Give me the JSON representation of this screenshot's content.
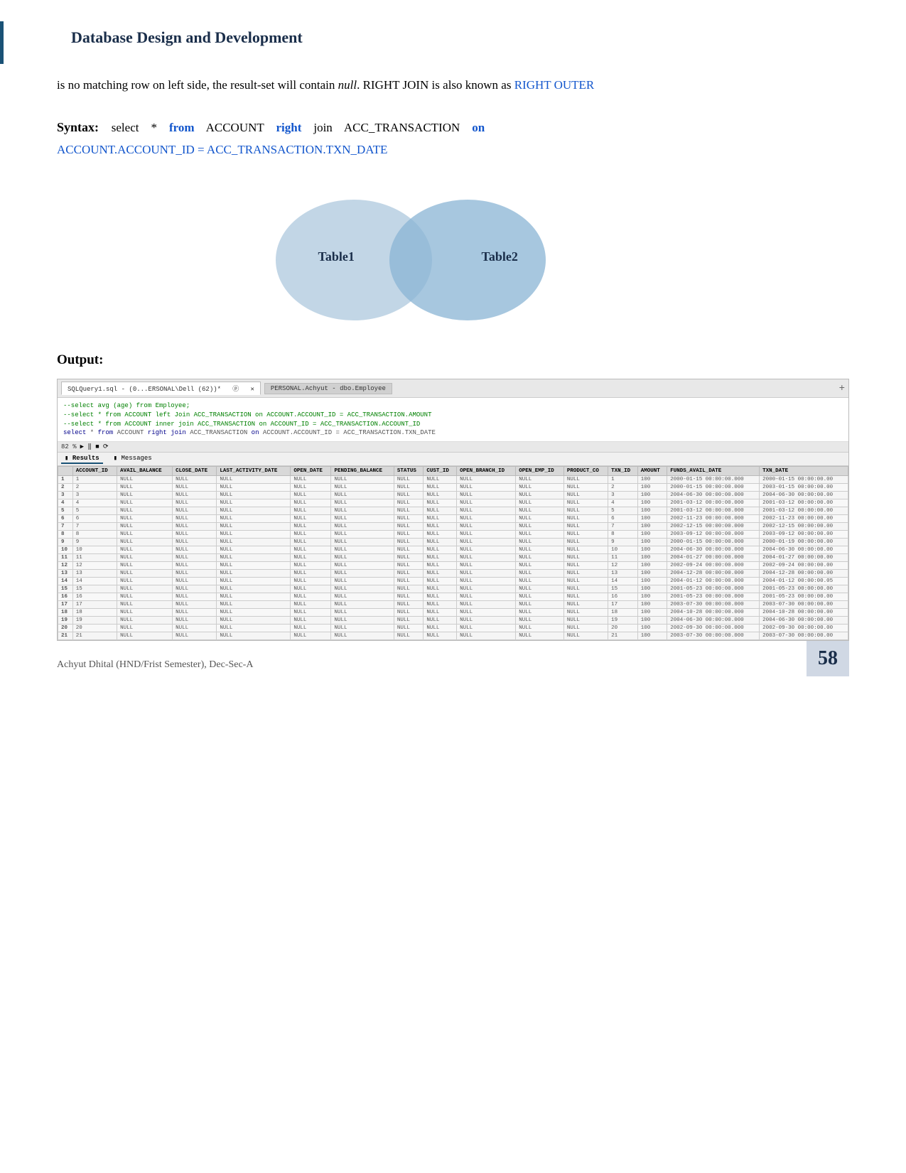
{
  "header": {
    "blue_bar": true,
    "title": "Database Design and Development"
  },
  "body": {
    "paragraph": "is no matching row on left side, the result-set will contain null. RIGHT JOIN is also known as RIGHT OUTER",
    "null_word": "null",
    "right_outer": "RIGHT OUTER",
    "syntax_label": "Syntax:",
    "syntax_line1": "select   *   from   ACCOUNT   right   join   ACC_TRANSACTION   on",
    "syntax_line2": "ACCOUNT.ACCOUNT_ID = ACC_TRANSACTION.TXN_DATE"
  },
  "venn": {
    "table1_label": "Table1",
    "table2_label": "Table2"
  },
  "output": {
    "label": "Output:",
    "tab_label": "SQLQuery1.sql - (0...ERSONAL\\Dell (62))*",
    "tab_label2": "PERSONAL.Achyut - dbo.Employee",
    "zoom": "82 %",
    "code_lines": [
      "--select avg (age) from Employee;",
      "--select * from ACCOUNT left Join ACC_TRANSACTION on ACCOUNT.ACCOUNT_ID = ACC_TRANSACTION.AMOUNT",
      "--select * from ACCOUNT inner join ACC_TRANSACTION on ACCOUNT_ID = ACC_TRANSACTION.ACCOUNT_ID",
      "select * from ACCOUNT right join ACC_TRANSACTION on ACCOUNT.ACCOUNT_ID = ACC_TRANSACTION.TXN_DATE"
    ],
    "results_tab": "Results",
    "messages_tab": "Messages",
    "columns": [
      "ACCOUNT_ID",
      "AVAIL_BALANCE",
      "CLOSE_DATE",
      "LAST_ACTIVITY_DATE",
      "OPEN_DATE",
      "PENDING_BALANCE",
      "STATUS",
      "CUST_ID",
      "OPEN_BRANCH_ID",
      "OPEN_EMP_ID",
      "PRODUCT_CO",
      "TXN_ID",
      "AMOUNT",
      "FUNDS_AVAIL_DATE",
      "TXN_DATE"
    ],
    "rows": [
      [
        "1",
        "NULL",
        "NULL",
        "NULL",
        "NULL",
        "NULL",
        "NULL",
        "NULL",
        "NULL",
        "NULL",
        "NULL",
        "1",
        "100",
        "2000-01-15 00:00:00.000",
        "2000-01-15 00:00:00.00"
      ],
      [
        "2",
        "NULL",
        "NULL",
        "NULL",
        "NULL",
        "NULL",
        "NULL",
        "NULL",
        "NULL",
        "NULL",
        "NULL",
        "2",
        "100",
        "2000-01-15 00:00:00.000",
        "2003-01-15 00:00:00.00"
      ],
      [
        "3",
        "NULL",
        "NULL",
        "NULL",
        "NULL",
        "NULL",
        "NULL",
        "NULL",
        "NULL",
        "NULL",
        "NULL",
        "3",
        "100",
        "2004-06-30 00:00:00.000",
        "2004-06-30 00:00:00.00"
      ],
      [
        "4",
        "NULL",
        "NULL",
        "NULL",
        "NULL",
        "NULL",
        "NULL",
        "NULL",
        "NULL",
        "NULL",
        "NULL",
        "4",
        "100",
        "2001-03-12 00:00:00.000",
        "2001-03-12 00:00:00.00"
      ],
      [
        "5",
        "NULL",
        "NULL",
        "NULL",
        "NULL",
        "NULL",
        "NULL",
        "NULL",
        "NULL",
        "NULL",
        "NULL",
        "5",
        "100",
        "2001-03-12 00:00:00.000",
        "2001-03-12 00:00:00.00"
      ],
      [
        "6",
        "NULL",
        "NULL",
        "NULL",
        "NULL",
        "NULL",
        "NULL",
        "NULL",
        "NULL",
        "NULL",
        "NULL",
        "6",
        "100",
        "2002-11-23 00:00:00.000",
        "2002-11-23 00:00:00.00"
      ],
      [
        "7",
        "NULL",
        "NULL",
        "NULL",
        "NULL",
        "NULL",
        "NULL",
        "NULL",
        "NULL",
        "NULL",
        "NULL",
        "7",
        "100",
        "2002-12-15 00:00:00.000",
        "2002-12-15 00:00:00.00"
      ],
      [
        "8",
        "NULL",
        "NULL",
        "NULL",
        "NULL",
        "NULL",
        "NULL",
        "NULL",
        "NULL",
        "NULL",
        "NULL",
        "8",
        "100",
        "2003-09-12 00:00:00.000",
        "2003-09-12 00:00:00.00"
      ],
      [
        "9",
        "NULL",
        "NULL",
        "NULL",
        "NULL",
        "NULL",
        "NULL",
        "NULL",
        "NULL",
        "NULL",
        "NULL",
        "9",
        "100",
        "2000-01-15 00:00:00.000",
        "2000-01-19 00:00:00.00"
      ],
      [
        "10",
        "NULL",
        "NULL",
        "NULL",
        "NULL",
        "NULL",
        "NULL",
        "NULL",
        "NULL",
        "NULL",
        "NULL",
        "10",
        "100",
        "2004-06-30 00:00:00.000",
        "2004-06-30 00:00:00.00"
      ],
      [
        "11",
        "NULL",
        "NULL",
        "NULL",
        "NULL",
        "NULL",
        "NULL",
        "NULL",
        "NULL",
        "NULL",
        "NULL",
        "11",
        "100",
        "2004-01-27 00:00:00.000",
        "2004-01-27 00:00:00.00"
      ],
      [
        "12",
        "NULL",
        "NULL",
        "NULL",
        "NULL",
        "NULL",
        "NULL",
        "NULL",
        "NULL",
        "NULL",
        "NULL",
        "12",
        "100",
        "2002-09-24 00:00:00.000",
        "2002-09-24 00:00:00.00"
      ],
      [
        "13",
        "NULL",
        "NULL",
        "NULL",
        "NULL",
        "NULL",
        "NULL",
        "NULL",
        "NULL",
        "NULL",
        "NULL",
        "13",
        "100",
        "2004-12-28 00:00:00.000",
        "2004-12-28 00:00:00.00"
      ],
      [
        "14",
        "NULL",
        "NULL",
        "NULL",
        "NULL",
        "NULL",
        "NULL",
        "NULL",
        "NULL",
        "NULL",
        "NULL",
        "14",
        "100",
        "2004-01-12 00:00:00.000",
        "2004-01-12 00:00:00.05"
      ],
      [
        "15",
        "NULL",
        "NULL",
        "NULL",
        "NULL",
        "NULL",
        "NULL",
        "NULL",
        "NULL",
        "NULL",
        "NULL",
        "15",
        "100",
        "2001-05-23 00:00:00.000",
        "2001-05-23 00:00:00.00"
      ],
      [
        "16",
        "NULL",
        "NULL",
        "NULL",
        "NULL",
        "NULL",
        "NULL",
        "NULL",
        "NULL",
        "NULL",
        "NULL",
        "16",
        "100",
        "2001-05-23 00:00:00.000",
        "2001-05-23 00:00:00.00"
      ],
      [
        "17",
        "NULL",
        "NULL",
        "NULL",
        "NULL",
        "NULL",
        "NULL",
        "NULL",
        "NULL",
        "NULL",
        "NULL",
        "17",
        "100",
        "2003-07-30 00:00:00.000",
        "2003-07-30 00:00:00.00"
      ],
      [
        "18",
        "NULL",
        "NULL",
        "NULL",
        "NULL",
        "NULL",
        "NULL",
        "NULL",
        "NULL",
        "NULL",
        "NULL",
        "18",
        "100",
        "2004-10-28 00:00:00.000",
        "2004-10-28 00:00:00.00"
      ],
      [
        "19",
        "NULL",
        "NULL",
        "NULL",
        "NULL",
        "NULL",
        "NULL",
        "NULL",
        "NULL",
        "NULL",
        "NULL",
        "19",
        "100",
        "2004-06-30 00:00:00.000",
        "2004-06-30 00:00:00.00"
      ],
      [
        "20",
        "NULL",
        "NULL",
        "NULL",
        "NULL",
        "NULL",
        "NULL",
        "NULL",
        "NULL",
        "NULL",
        "NULL",
        "20",
        "100",
        "2002-09-30 00:00:00.000",
        "2002-09-30 00:00:00.00"
      ],
      [
        "21",
        "NULL",
        "NULL",
        "NULL",
        "NULL",
        "NULL",
        "NULL",
        "NULL",
        "NULL",
        "NULL",
        "NULL",
        "21",
        "100",
        "2003-07-30 00:00:00.000",
        "2003-07-30 00:00:00.00"
      ]
    ]
  },
  "footer": {
    "text": "Achyut Dhital (HND/Frist Semester), Dec-Sec-A",
    "page_number": "58"
  }
}
